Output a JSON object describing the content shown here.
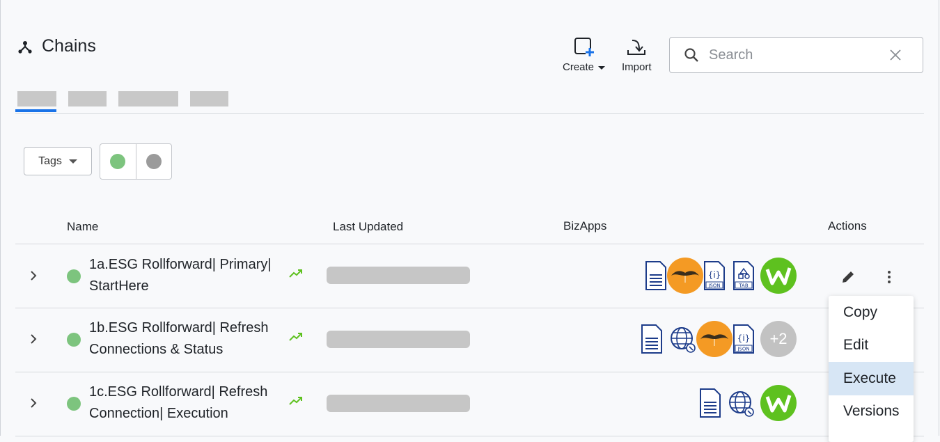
{
  "header": {
    "title": "Chains",
    "title_icon": "chain-network-icon",
    "create_label": "Create",
    "import_label": "Import"
  },
  "search": {
    "placeholder": "Search",
    "value": ""
  },
  "tabs": {
    "count": 4,
    "active_index": 0,
    "accent_color": "#1a73e8"
  },
  "filters": {
    "tags_label": "Tags",
    "status_options": [
      {
        "name": "active",
        "color": "#7dc47e"
      },
      {
        "name": "inactive",
        "color": "#9b9b9b"
      }
    ]
  },
  "table": {
    "columns": [
      "Name",
      "Last Updated",
      "BizApps",
      "Actions"
    ],
    "rows": [
      {
        "name_line1": "1a.ESG Rollforward| Primary|",
        "name_line2": "StartHere",
        "status_color": "#7dc47e",
        "bizapps": [
          "document-icon",
          "mustache-icon",
          "json-icon",
          "tab-icon",
          "w-icon"
        ]
      },
      {
        "name_line1": "1b.ESG Rollforward| Refresh",
        "name_line2": "Connections & Status",
        "status_color": "#7dc47e",
        "bizapps": [
          "document-icon",
          "globe-icon",
          "mustache-icon",
          "json-icon"
        ],
        "bizapps_more": "+2"
      },
      {
        "name_line1": "1c.ESG Rollforward| Refresh",
        "name_line2": "Connection| Execution",
        "status_color": "#7dc47e",
        "bizapps": [
          "document-icon",
          "globe-icon",
          "w-icon"
        ]
      }
    ]
  },
  "context_menu": {
    "items": [
      "Copy",
      "Edit",
      "Execute",
      "Versions"
    ],
    "highlighted": "Execute"
  }
}
